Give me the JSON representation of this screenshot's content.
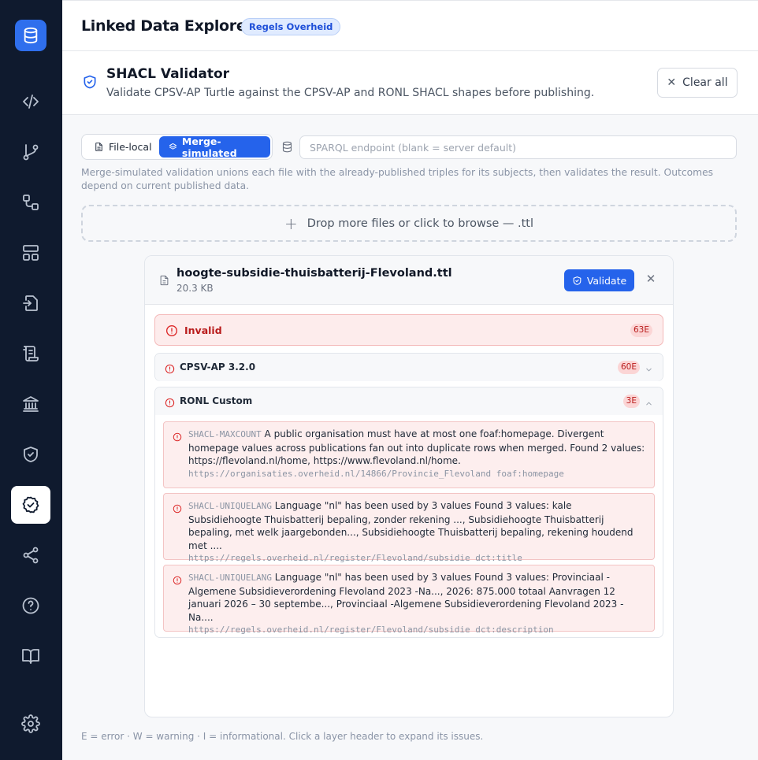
{
  "app": {
    "title": "Linked Data Explorer",
    "badge": "Regels Overheid"
  },
  "sidebar": {
    "items": [
      {
        "icon": "database-icon"
      },
      {
        "icon": "code-icon"
      },
      {
        "icon": "git-branch-icon"
      },
      {
        "icon": "workflow-icon"
      },
      {
        "icon": "layout-icon"
      },
      {
        "icon": "file-import-icon"
      },
      {
        "icon": "scroll-icon"
      },
      {
        "icon": "landmark-icon"
      },
      {
        "icon": "shield-check-icon"
      },
      {
        "icon": "circle-check-icon",
        "active": true
      },
      {
        "icon": "share-icon"
      },
      {
        "icon": "help-circle-icon"
      },
      {
        "icon": "book-open-icon"
      },
      {
        "icon": "settings-icon"
      }
    ]
  },
  "header": {
    "title": "SHACL Validator",
    "subtitle": "Validate CPSV-AP Turtle against the CPSV-AP and RONL SHACL shapes before publishing.",
    "clear_label": "Clear all"
  },
  "mode": {
    "local_label": "File-local",
    "merge_label": "Merge-simulated",
    "selected": "Merge-simulated"
  },
  "sparql": {
    "placeholder": "SPARQL endpoint (blank = server default)",
    "value": ""
  },
  "hint": "Merge-simulated validation unions each file with the already-published triples for its subjects, then validates the result. Outcomes depend on current published data.",
  "dropzone": {
    "label": "Drop more files or click to browse — .ttl"
  },
  "file": {
    "name": "hoogte-subsidie-thuisbatterij-Flevoland.ttl",
    "size": "20.3 KB",
    "validate_label": "Validate",
    "status": {
      "label": "Invalid",
      "count": "63E"
    },
    "layers": [
      {
        "name": "CPSV-AP 3.2.0",
        "count": "60E",
        "expanded": false
      },
      {
        "name": "RONL Custom",
        "count": "3E",
        "expanded": true,
        "issues": [
          {
            "code": "SHACL-MAXCOUNT",
            "message": "A public organisation must have at most one foaf:homepage. Divergent homepage values across publications fan out into duplicate rows when merged. Found 2 values: https://flevoland.nl/home, https://www.flevoland.nl/home.",
            "focus": "https://organisaties.overheid.nl/14866/Provincie_Flevoland foaf:homepage"
          },
          {
            "code": "SHACL-UNIQUELANG",
            "message": "Language \"nl\" has been used by 3 values Found 3 values: kale Subsidiehoogte Thuisbatterij bepaling, zonder rekening ..., Subsidiehoogte Thuisbatterij bepaling, met welk jaargebonden..., Subsidiehoogte Thuisbatterij bepaling, rekening houdend met ....",
            "focus": "https://regels.overheid.nl/register/Flevoland/subsidie dct:title"
          },
          {
            "code": "SHACL-UNIQUELANG",
            "message": "Language \"nl\" has been used by 3 values Found 3 values: Provinciaal -Algemene Subsidieverordening Flevoland 2023 -Na..., 2026: 875.000 totaal Aanvragen 12 januari 2026 – 30 septembe..., Provinciaal -Algemene Subsidieverordening Flevoland 2023 -Na....",
            "focus": "https://regels.overheid.nl/register/Flevoland/subsidie dct:description"
          }
        ]
      }
    ]
  },
  "legend": "E = error · W = warning · I = informational. Click a layer header to expand its issues.",
  "colors": {
    "sidebar_bg": "#0f1a2e",
    "accent": "#2563eb",
    "error": "#dc2626",
    "error_bg": "#fdecec"
  }
}
